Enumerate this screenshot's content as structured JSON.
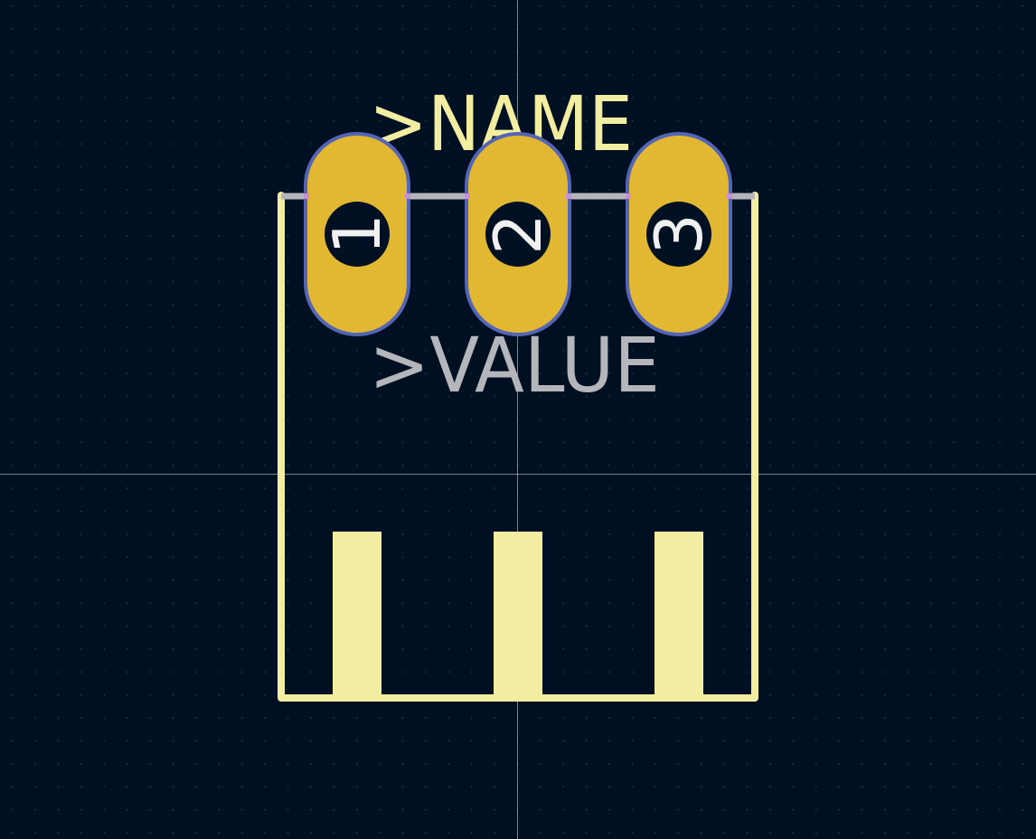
{
  "footprint": {
    "name_label": ">NAME",
    "value_label": ">VALUE",
    "pads": [
      {
        "number": "1"
      },
      {
        "number": "2"
      },
      {
        "number": "3"
      }
    ]
  },
  "colors": {
    "background": "#001023",
    "grid_dot": "#3a4a60",
    "crosshair": "#c8ccd4",
    "silkscreen": "#f2eda1",
    "pad_fill": "#e2b731",
    "pad_outline": "#5465b5",
    "drill_hole": "#001023",
    "pad_number": "#f0f0f0",
    "value_text": "#b4b6bb",
    "fab_line": "#b4b6bb",
    "courtyard_tick": "#c98fd0"
  }
}
